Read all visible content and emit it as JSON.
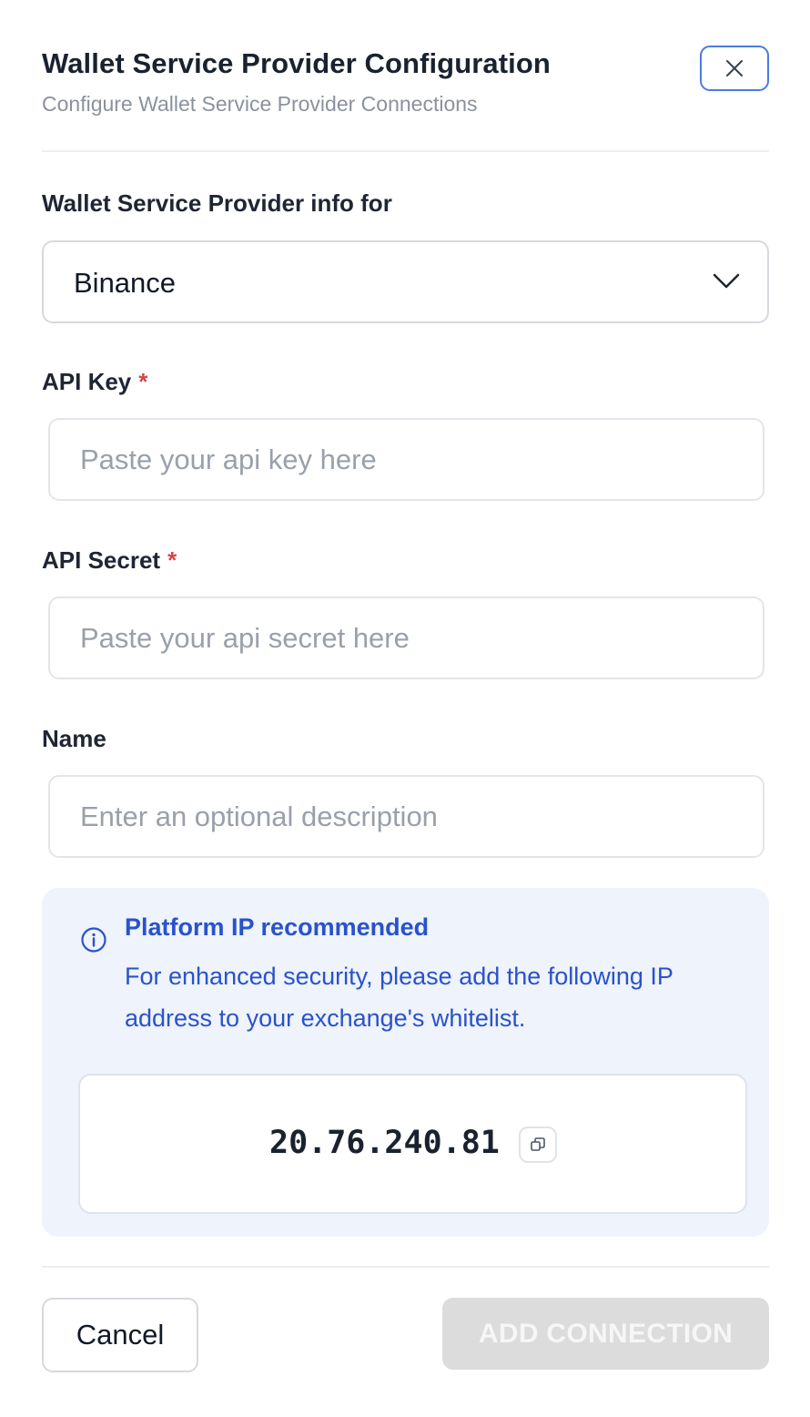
{
  "dialog": {
    "title": "Wallet Service Provider Configuration",
    "subtitle": "Configure Wallet Service Provider Connections",
    "close_icon": "close-icon"
  },
  "provider": {
    "label": "Wallet Service Provider info for",
    "selected": "Binance",
    "chevron_icon": "chevron-down-icon"
  },
  "api_key": {
    "label": "API Key",
    "required_mark": "*",
    "value": "",
    "placeholder": "Paste your api key here"
  },
  "api_secret": {
    "label": "API Secret",
    "required_mark": "*",
    "value": "",
    "placeholder": "Paste your api secret here"
  },
  "name": {
    "label": "Name",
    "value": "",
    "placeholder": "Enter an optional description"
  },
  "notice": {
    "icon": "info-icon",
    "title": "Platform IP recommended",
    "text": "For enhanced security, please add the following IP address to your exchange's whitelist.",
    "ip": "20.76.240.81",
    "copy_icon": "copy-icon"
  },
  "footer": {
    "cancel_label": "Cancel",
    "add_label": "ADD CONNECTION"
  },
  "colors": {
    "accent_blue": "#2a52c9",
    "focus_border": "#4a7be0",
    "info_background": "#eef3fc",
    "required_red": "#d64545",
    "disabled_button": "#dcdcdc"
  }
}
